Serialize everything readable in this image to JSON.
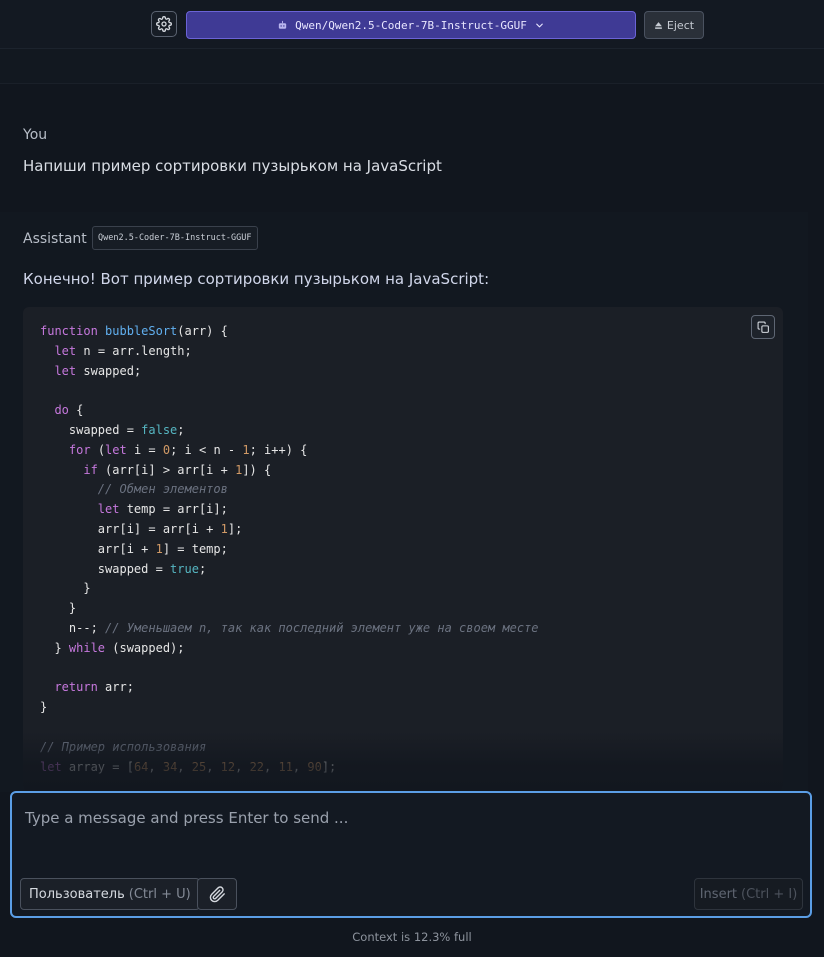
{
  "header": {
    "model_name": "Qwen/Qwen2.5-Coder-7B-Instruct-GGUF",
    "eject_label": "Eject"
  },
  "messages": [
    {
      "role": "You",
      "text": "Напиши пример сортировки пузырьком на JavaScript"
    },
    {
      "role": "Assistant",
      "model_tag": "Qwen2.5-Coder-7B-Instruct-GGUF",
      "text": "Конечно! Вот пример сортировки пузырьком на JavaScript:",
      "code_lines": [
        "function bubbleSort(arr) {",
        "  let n = arr.length;",
        "  let swapped;",
        "",
        "  do {",
        "    swapped = false;",
        "    for (let i = 0; i < n - 1; i++) {",
        "      if (arr[i] > arr[i + 1]) {",
        "        // Обмен элементов",
        "        let temp = arr[i];",
        "        arr[i] = arr[i + 1];",
        "        arr[i + 1] = temp;",
        "        swapped = true;",
        "      }",
        "    }",
        "    n--; // Уменьшаем n, так как последний элемент уже на своем месте",
        "  } while (swapped);",
        "",
        "  return arr;",
        "}",
        "",
        "// Пример использования",
        "let array = [64, 34, 25, 12, 22, 11, 90];"
      ]
    }
  ],
  "composer": {
    "placeholder": "Type a message and press Enter to send ...",
    "role_label": "Пользователь",
    "role_hint": "(Ctrl + U)",
    "insert_label": "Insert",
    "insert_hint": "(Ctrl + I)"
  },
  "footer": {
    "context_text": "Context is 12.3% full"
  },
  "icons": {
    "settings": "gear-icon",
    "model": "robot-icon",
    "model_dropdown": "chevron-down-icon",
    "eject": "eject-icon",
    "copy": "copy-icon",
    "attach": "paperclip-icon"
  },
  "colors": {
    "accent": "#3f3a95",
    "input_border": "#5b9ee6",
    "background": "#11161e"
  }
}
